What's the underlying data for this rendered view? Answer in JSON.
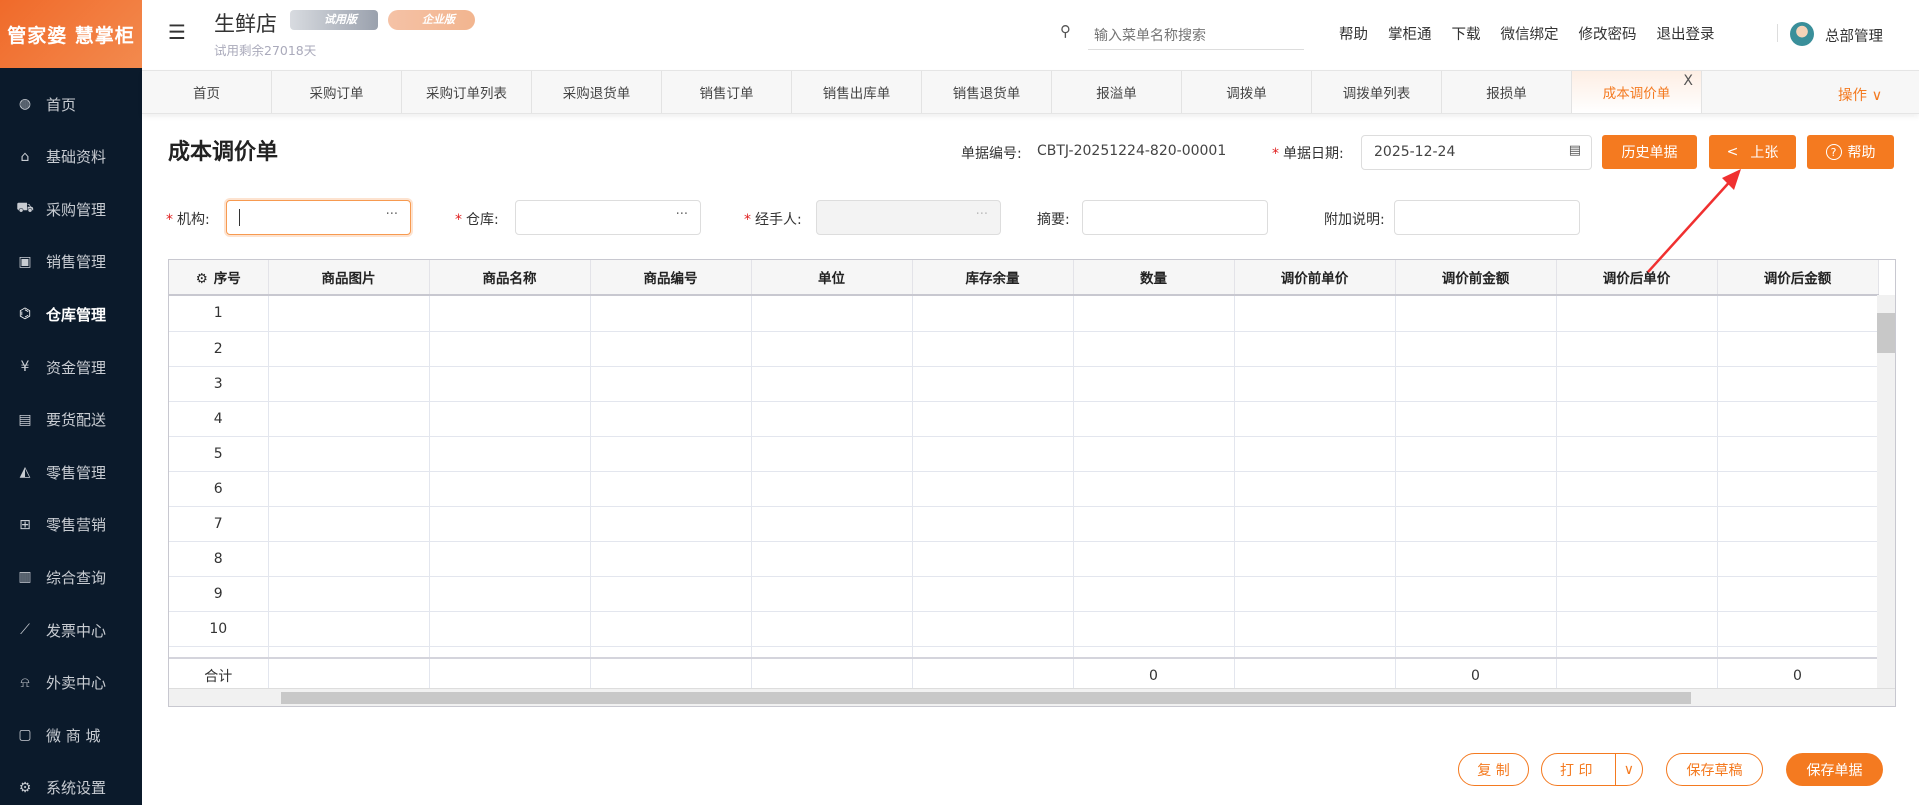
{
  "logo": "管家婆 慧掌柜",
  "header": {
    "store_name": "生鲜店",
    "badge_trial": "试用版",
    "badge_enterprise": "企业版",
    "trial_remaining": "试用剩余27018天",
    "search_placeholder": "输入菜单名称搜索",
    "links": [
      "帮助",
      "掌柜通",
      "下载",
      "微信绑定",
      "修改密码",
      "退出登录"
    ],
    "user": "总部管理"
  },
  "sidebar": [
    {
      "label": "首页",
      "icon": "globe-icon"
    },
    {
      "label": "基础资料",
      "icon": "home-icon"
    },
    {
      "label": "采购管理",
      "icon": "cart-icon"
    },
    {
      "label": "销售管理",
      "icon": "calendar-icon"
    },
    {
      "label": "仓库管理",
      "icon": "bank-icon",
      "active": true
    },
    {
      "label": "资金管理",
      "icon": "money-icon"
    },
    {
      "label": "要货配送",
      "icon": "list-icon"
    },
    {
      "label": "零售管理",
      "icon": "chart-area-icon"
    },
    {
      "label": "零售营销",
      "icon": "gift-icon"
    },
    {
      "label": "综合查询",
      "icon": "bar-chart-icon"
    },
    {
      "label": "发票中心",
      "icon": "line-chart-icon"
    },
    {
      "label": "外卖中心",
      "icon": "alarm-icon"
    },
    {
      "label": "微 商 城",
      "icon": "bag-icon"
    },
    {
      "label": "系统设置",
      "icon": "gear-icon"
    }
  ],
  "tabs": [
    "首页",
    "采购订单",
    "采购订单列表",
    "采购退货单",
    "销售订单",
    "销售出库单",
    "销售退货单",
    "报溢单",
    "调拨单",
    "调拨单列表",
    "报损单",
    "成本调价单"
  ],
  "tab_close": "X",
  "operate": "操作 ∨",
  "form": {
    "title": "成本调价单",
    "doc_no_label": "单据编号:",
    "doc_no": "CBTJ-20251224-820-00001",
    "date_label": "单据日期:",
    "date": "2025-12-24",
    "btn_history": "历史单据",
    "btn_prev": "上张",
    "btn_help": "帮助",
    "org_label": "机构:",
    "warehouse_label": "仓库:",
    "handler_label": "经手人:",
    "summary_label": "摘要:",
    "note_label": "附加说明:",
    "org_value": "",
    "warehouse_value": "",
    "summary_value": "",
    "note_value": ""
  },
  "table": {
    "columns": [
      "序号",
      "商品图片",
      "商品名称",
      "商品编号",
      "单位",
      "库存余量",
      "数量",
      "调价前单价",
      "调价前金额",
      "调价后单价",
      "调价后金额"
    ],
    "rows": [
      "1",
      "2",
      "3",
      "4",
      "5",
      "6",
      "7",
      "8",
      "9",
      "10"
    ],
    "total_label": "合计",
    "totals": [
      "",
      "",
      "",
      "",
      "",
      "0",
      "",
      "0",
      "",
      "0"
    ]
  },
  "footer": {
    "copy": "复 制",
    "print": "打 印",
    "save_draft": "保存草稿",
    "save": "保存单据"
  },
  "colors": {
    "accent": "#f47a20",
    "sidebar": "#0b1a2b"
  }
}
